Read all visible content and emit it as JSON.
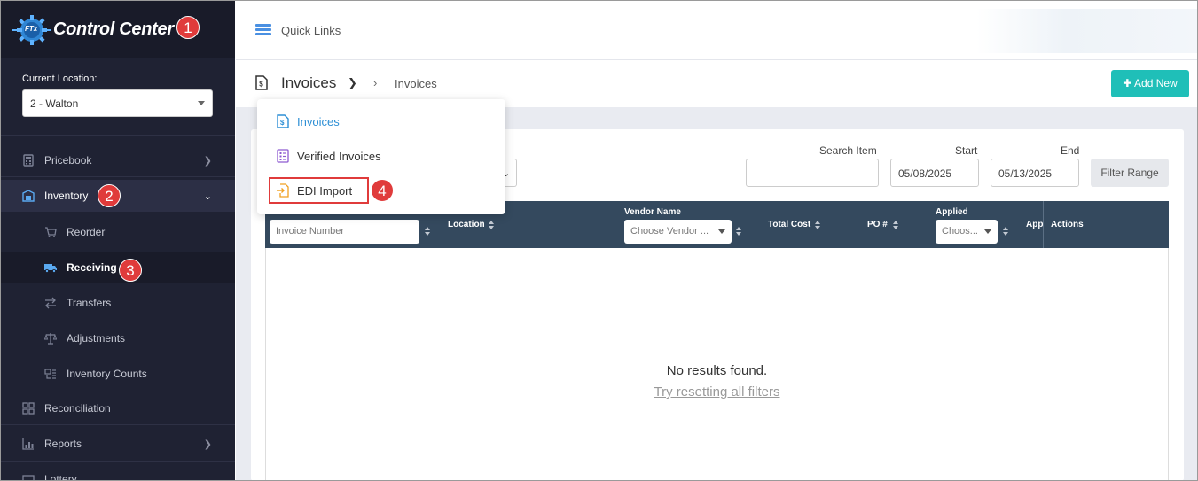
{
  "brand": {
    "name": "Control Center",
    "logo_text": "FTx"
  },
  "location": {
    "label": "Current Location:",
    "value": "2 - Walton"
  },
  "nav": {
    "pricebook": "Pricebook",
    "inventory": "Inventory",
    "reorder": "Reorder",
    "receiving": "Receiving",
    "transfers": "Transfers",
    "adjustments": "Adjustments",
    "inventory_counts": "Inventory Counts",
    "reconciliation": "Reconciliation",
    "reports": "Reports",
    "lottery": "Lottery"
  },
  "badges": [
    "1",
    "2",
    "3",
    "4"
  ],
  "topbar": {
    "quick_links": "Quick Links"
  },
  "header": {
    "title": "Invoices",
    "breadcrumb": "Invoices",
    "add_new": "Add New"
  },
  "dropdown": {
    "items": [
      "Invoices",
      "Verified Invoices",
      "EDI Import"
    ]
  },
  "filters": {
    "search_item_label": "Search Item",
    "start_label": "Start",
    "start_value": "05/08/2025",
    "end_label": "End",
    "end_value": "05/13/2025",
    "filter_range": "Filter Range"
  },
  "table": {
    "columns": {
      "invoice_number": "Invoice Number",
      "location": "Location",
      "vendor_name": "Vendor Name",
      "total_cost": "Total Cost",
      "po": "PO #",
      "applied": "Applied",
      "app": "App",
      "actions": "Actions"
    },
    "invoice_placeholder": "Invoice Number",
    "vendor_placeholder": "Choose Vendor ...",
    "applied_placeholder": "Choos...",
    "empty_message": "No results found.",
    "reset_link": "Try resetting all filters"
  },
  "colors": {
    "sidebar": "#1f2233",
    "accent": "#1fbfb8",
    "header_row": "#34495e",
    "badge": "#e03b3b",
    "link": "#2d8fd5"
  }
}
